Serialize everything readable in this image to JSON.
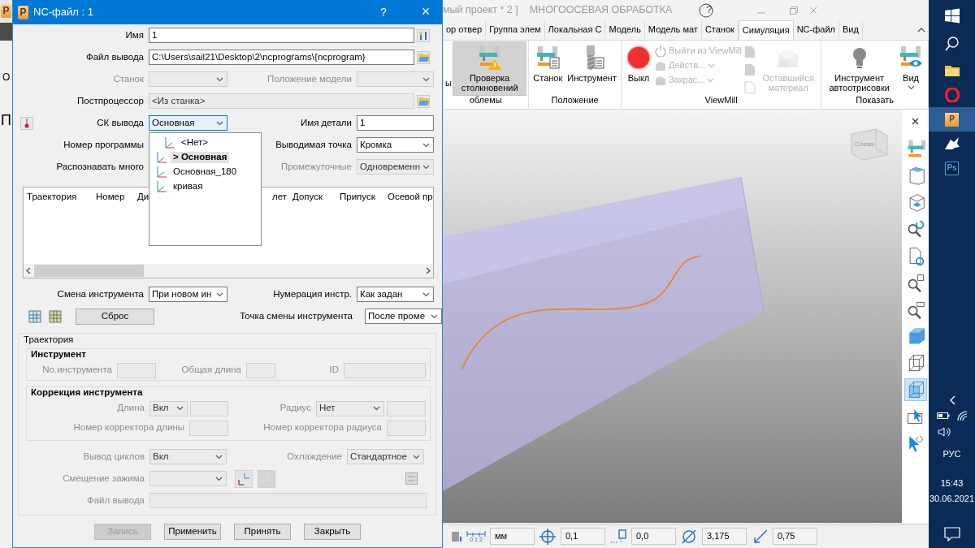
{
  "app": {
    "title": "мый проект * 2 ]",
    "mode": "МНОГООСЕВАЯ ОБРАБОТКА",
    "help": "?",
    "sidebar": {
      "icon_letter": "P",
      "button_fragment": "О",
      "panel_fragment": "П"
    },
    "tabs": [
      {
        "label": "ор отвер",
        "selected": false
      },
      {
        "label": "Группа элем",
        "selected": false
      },
      {
        "label": "Локальная С",
        "selected": false
      },
      {
        "label": "Модель",
        "selected": false
      },
      {
        "label": "Модель мат",
        "selected": false
      },
      {
        "label": "Станок",
        "selected": false
      },
      {
        "label": "Симуляция",
        "selected": true
      },
      {
        "label": "NC-файл",
        "selected": false
      },
      {
        "label": "Вид",
        "selected": false
      }
    ],
    "ribbon": [
      {
        "label": "облемы",
        "items": [
          {
            "kind": "fragment",
            "label": "ы"
          },
          {
            "kind": "large",
            "label": "Проверка столкновений",
            "selected": true,
            "disabled": false
          }
        ]
      },
      {
        "label": "Положение",
        "items": [
          {
            "kind": "large",
            "label": "Станок",
            "selected": false,
            "disabled": false
          },
          {
            "kind": "large",
            "label": "Инструмент",
            "selected": false,
            "disabled": false
          }
        ]
      },
      {
        "label": "ViewMill",
        "items": [
          {
            "kind": "large",
            "label": "Выкл",
            "selected": false,
            "disabled": false
          },
          {
            "kind": "small",
            "label": "Выйти из ViewMill",
            "disabled": true
          },
          {
            "kind": "small_dropdown",
            "label": "Действ...",
            "disabled": true
          },
          {
            "kind": "small_dropdown",
            "label": "Закрас...",
            "disabled": true
          },
          {
            "kind": "icons",
            "disabled": true
          },
          {
            "kind": "large",
            "label": "Оставшийся материал",
            "selected": false,
            "disabled": true
          }
        ]
      },
      {
        "label": "Показать",
        "items": [
          {
            "kind": "large",
            "label": "Инструмент автоотрисовки",
            "selected": false,
            "disabled": false
          },
          {
            "kind": "large_dropdown",
            "label": "Вид",
            "selected": false,
            "disabled": false
          }
        ]
      }
    ],
    "viewport": {
      "cube_label": "Слева"
    },
    "view_toolbar": [
      {
        "selected": false
      },
      {
        "selected": false
      },
      {
        "selected": false
      },
      {
        "selected": false
      },
      {
        "selected": false
      },
      {
        "selected": false
      },
      {
        "selected": false
      },
      {
        "selected": false
      },
      {
        "selected": false
      },
      {
        "selected": true
      },
      {
        "selected": false
      },
      {
        "selected": false
      }
    ],
    "status_bar": {
      "ruler_digits": "0 1 2",
      "fields": [
        {
          "value": "мм"
        },
        {
          "value": "0,1"
        },
        {
          "value": "0,0"
        },
        {
          "value": "3,175"
        },
        {
          "value": "0,75"
        }
      ]
    }
  },
  "taskbar": {
    "apps": [
      {
        "kind": "folder",
        "selected": false
      },
      {
        "kind": "opera",
        "selected": false
      },
      {
        "kind": "letter",
        "label": "P",
        "selected": true
      },
      {
        "kind": "rhino",
        "selected": false
      },
      {
        "kind": "letter",
        "label": "Ps",
        "selected": false
      }
    ],
    "language": "РУС",
    "time": "15:43",
    "date": "30.06.2021"
  },
  "dialog": {
    "icon_letter": "P",
    "title": "NC-файл : 1",
    "help": "?",
    "close": "×",
    "name": {
      "label": "Имя",
      "value": "1"
    },
    "output_file": {
      "label": "Файл вывода",
      "value": "C:\\Users\\sail21\\Desktop\\2\\ncprograms\\{ncprogram}"
    },
    "machine": {
      "label": "Станок",
      "disabled": true
    },
    "model_position": {
      "label": "Положение модели",
      "disabled": true
    },
    "postprocessor": {
      "label": "Постпроцессор",
      "value": "<Из станка>",
      "disabled": true
    },
    "output_cs": {
      "label": "СК вывода",
      "value": "Основная",
      "expanded": true,
      "options": [
        {
          "label": "<Нет>",
          "selected": false
        },
        {
          "label": "> Основная",
          "selected": true
        },
        {
          "label": "Основная_180",
          "selected": false
        },
        {
          "label": "кривая",
          "selected": false
        }
      ]
    },
    "part_name": {
      "label": "Имя детали",
      "value": "1"
    },
    "program_number": {
      "label": "Номер программы"
    },
    "output_point": {
      "label": "Выводимая точка",
      "value": "Кромка"
    },
    "recognize": {
      "label": "Распознавать много"
    },
    "intermediate": {
      "label": "Промежуточные",
      "value": "Одновременн",
      "disabled": true
    },
    "table": {
      "columns": [
        "Траектория",
        "Номер",
        "Ди",
        "лет",
        "Допуск",
        "Припуск",
        "Осевой пр"
      ]
    },
    "tool_change": {
      "label": "Смена инструмента",
      "value": "При новом ин"
    },
    "tool_numbering": {
      "label": "Нумерация инстр.",
      "value": "Как задан"
    },
    "reset": "Сброс",
    "tool_change_point": {
      "label": "Точка смены инструмента",
      "value": "После проме"
    },
    "toolpath_group": {
      "title": "Траектория",
      "disabled": true,
      "tool_box": {
        "title": "Инструмент",
        "fields": [
          {
            "label": "No.инструмента"
          },
          {
            "label": "Общая длина"
          },
          {
            "label": "ID"
          }
        ]
      },
      "correction_box": {
        "title": "Коррекция инструмента",
        "fields": [
          {
            "label": "Длина",
            "value": "Вкл"
          },
          {
            "label": "Радиус",
            "value": "Нет"
          },
          {
            "label": "Номер корректора длины"
          },
          {
            "label": "Номер корректора радиуса"
          }
        ]
      },
      "fields": [
        {
          "label": "Вывод циклов",
          "value": "Вкл"
        },
        {
          "label": "Охлаждение",
          "value": "Стандартное"
        },
        {
          "label": "Смещение зажима"
        },
        {
          "label": "Файл вывода"
        }
      ]
    },
    "buttons": [
      {
        "label": "Запись",
        "disabled": true
      },
      {
        "label": "Применить",
        "disabled": false
      },
      {
        "label": "Принять",
        "disabled": false
      },
      {
        "label": "Закрыть",
        "disabled": false
      }
    ]
  }
}
